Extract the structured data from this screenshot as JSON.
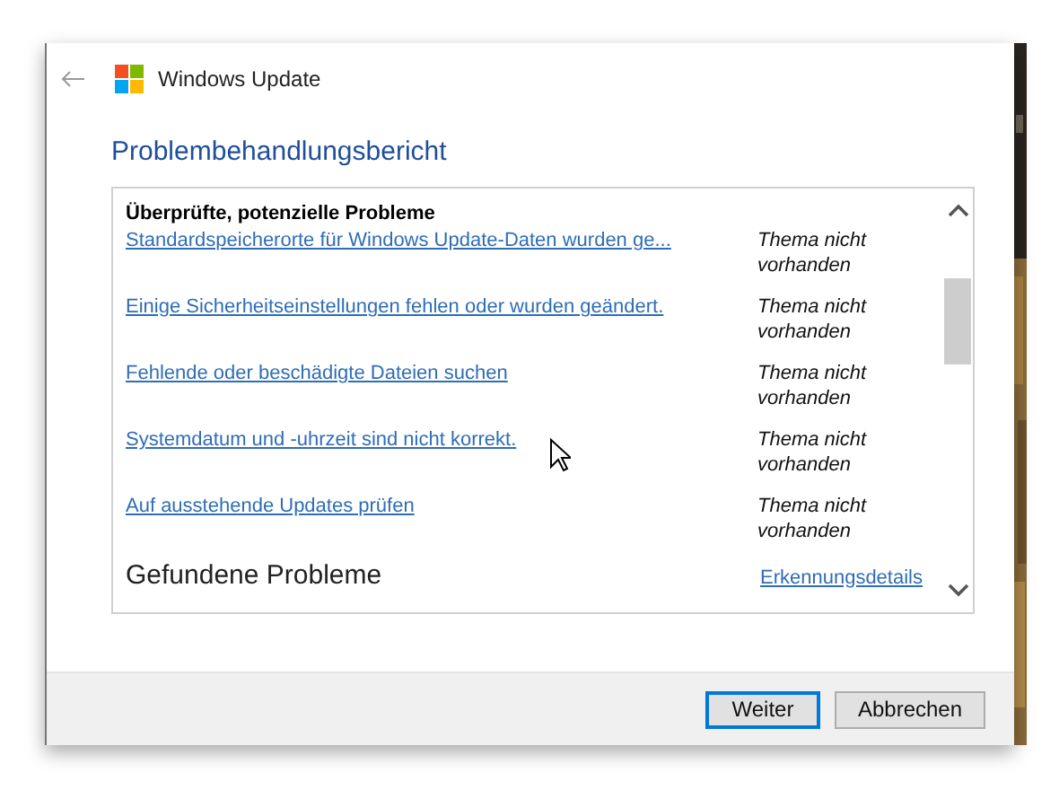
{
  "window": {
    "title": "Windows Update"
  },
  "heading": "Problembehandlungsbericht",
  "report": {
    "section_title": "Überprüfte, potenzielle Probleme",
    "rows": [
      {
        "issue": "Standardspeicherorte für Windows Update-Daten wurden ge...",
        "status": "Thema nicht vorhanden"
      },
      {
        "issue": "Einige Sicherheitseinstellungen fehlen oder wurden geändert.",
        "status": "Thema nicht vorhanden"
      },
      {
        "issue": "Fehlende oder beschädigte Dateien suchen",
        "status": "Thema nicht vorhanden"
      },
      {
        "issue": "Systemdatum und -uhrzeit sind nicht korrekt.",
        "status": "Thema nicht vorhanden"
      },
      {
        "issue": "Auf ausstehende Updates prüfen",
        "status": "Thema nicht vorhanden"
      }
    ],
    "next_section_title": "Gefundene Probleme",
    "details_link": "Erkennungsdetails"
  },
  "buttons": [
    {
      "label": "Weiter",
      "default": true
    },
    {
      "label": "Abbrechen",
      "default": false
    }
  ]
}
